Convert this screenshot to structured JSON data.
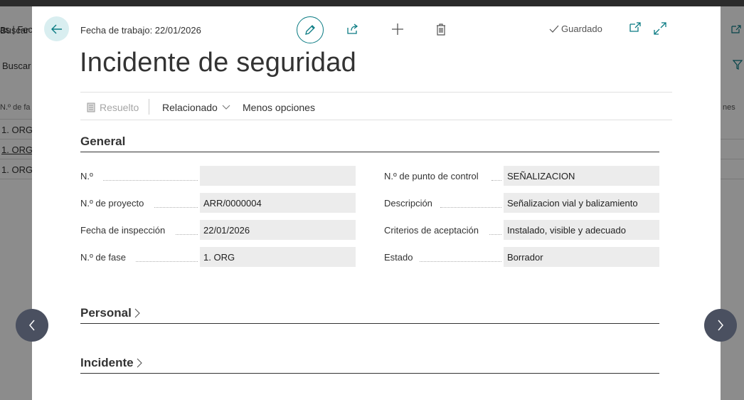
{
  "background": {
    "breadcrumb": "as | Fech",
    "search_label": "Buscar",
    "column_header": "N.º de fa",
    "column_header_right": "nes",
    "rows": [
      "1. ORG",
      "1. ORG",
      "1. ORG"
    ]
  },
  "header": {
    "work_date": "Fecha de trabajo: 22/01/2026",
    "saved_status": "Guardado"
  },
  "page_title": "Incidente de seguridad",
  "actions": {
    "resolved": "Resuelto",
    "related": "Relacionado",
    "fewer_options": "Menos opciones"
  },
  "sections": {
    "general": "General",
    "personal": "Personal",
    "incident": "Incidente"
  },
  "fields_left": [
    {
      "label": "N.º",
      "value": ""
    },
    {
      "label": "N.º de proyecto",
      "value": "ARR/0000004"
    },
    {
      "label": "Fecha de inspección",
      "value": "22/01/2026"
    },
    {
      "label": "N.º de fase",
      "value": "1. ORG"
    }
  ],
  "fields_right": [
    {
      "label": "N.º de punto de control",
      "value": "SEÑALIZACION"
    },
    {
      "label": "Descripción",
      "value": "Señalizacion vial y balizamiento"
    },
    {
      "label": "Criterios de aceptación",
      "value": "Instalado, visible y adecuado"
    },
    {
      "label": "Estado",
      "value": "Borrador"
    }
  ],
  "colors": {
    "accent": "#0a7b83",
    "field_bg": "#ececec",
    "nav_button": "#4a5060"
  },
  "icons": [
    "back-arrow-icon",
    "edit-pencil-icon",
    "share-icon",
    "add-icon",
    "delete-icon",
    "check-icon",
    "open-new-window-icon",
    "expand-icon",
    "document-icon",
    "chevron-down-icon",
    "chevron-right-icon",
    "chevron-left-icon"
  ]
}
